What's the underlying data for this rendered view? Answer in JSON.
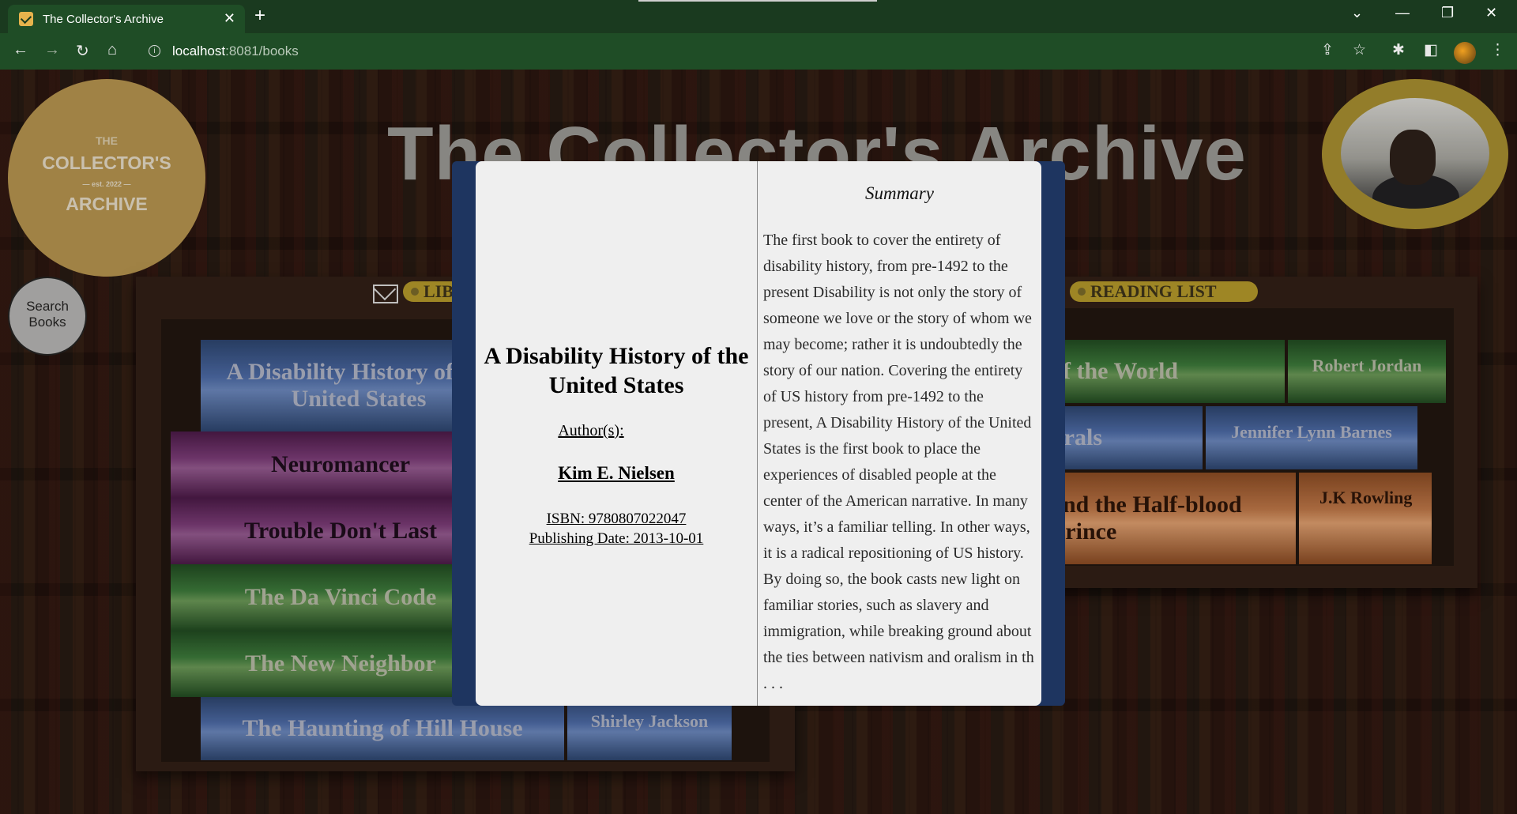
{
  "browser": {
    "tab_title": "The Collector's Archive",
    "url_host": "localhost",
    "url_path": ":8081/books",
    "icons": [
      "envelope-favicon",
      "close-icon",
      "plus-icon",
      "chevron-down-icon",
      "minimize-icon",
      "restore-icon",
      "close-window-icon",
      "back-icon",
      "forward-icon",
      "reload-icon",
      "home-icon",
      "info-icon",
      "share-icon",
      "star-icon",
      "extensions-icon",
      "sidebar-icon",
      "profile-avatar",
      "menu-icon"
    ]
  },
  "header": {
    "logo_the": "THE",
    "logo_collectors": "COLLECTOR'S",
    "logo_est": "— est. 2022 —",
    "logo_archive": "ARCHIVE",
    "site_title": "The Collector's Archive"
  },
  "search_button": {
    "line1": "Search",
    "line2": "Books"
  },
  "shelves": {
    "library_label": "LIBRARY",
    "reading_list_label": "READING LIST"
  },
  "library_books": [
    {
      "title": "A Disability History of the United States",
      "color": "blue"
    },
    {
      "title": "Neuromancer",
      "color": "purple"
    },
    {
      "title": "Trouble Don't Last",
      "color": "purple"
    },
    {
      "title": "The Da Vinci Code",
      "color": "green"
    },
    {
      "title": "The New Neighbor",
      "color": "green"
    },
    {
      "title": "The Haunting of Hill House",
      "author": "Shirley Jackson",
      "color": "blue"
    }
  ],
  "reading_list": [
    {
      "title": "of the World",
      "author": "Robert Jordan",
      "color": "green"
    },
    {
      "title": "urals",
      "author": "Jennifer Lynn Barnes",
      "color": "blue"
    },
    {
      "title": "and the Half-blood Prince",
      "author": "J.K Rowling",
      "color": "orange"
    }
  ],
  "modal": {
    "title": "A Disability History of the United States",
    "author_label": "Author(s):",
    "author": "Kim E. Nielsen",
    "isbn": "ISBN: 9780807022047",
    "publishing_date": "Publishing Date: 2013-10-01",
    "summary_heading": "Summary",
    "summary": "The first book to cover the entirety of disability history, from pre-1492 to the present Disability is not only the story of someone we love or the story of whom we may become; rather it is undoubtedly the story of our nation. Covering the entirety of US history from pre-1492 to the present, A Disability History of the United States is the first book to place the experiences of disabled people at the center of the American narrative. In many ways, it’s a familiar telling. In other ways, it is a radical repositioning of US history. By doing so, the book casts new light on familiar stories, such as slavery and immigration, while breaking ground about the ties between nativism and oralism in th . . ."
  },
  "colors": {
    "chrome_dark": "#1a3a1f",
    "chrome_toolbar": "#1f4d26",
    "gold": "#b8964f",
    "modal_frame": "#1e3560",
    "modal_bg": "#efefef"
  }
}
